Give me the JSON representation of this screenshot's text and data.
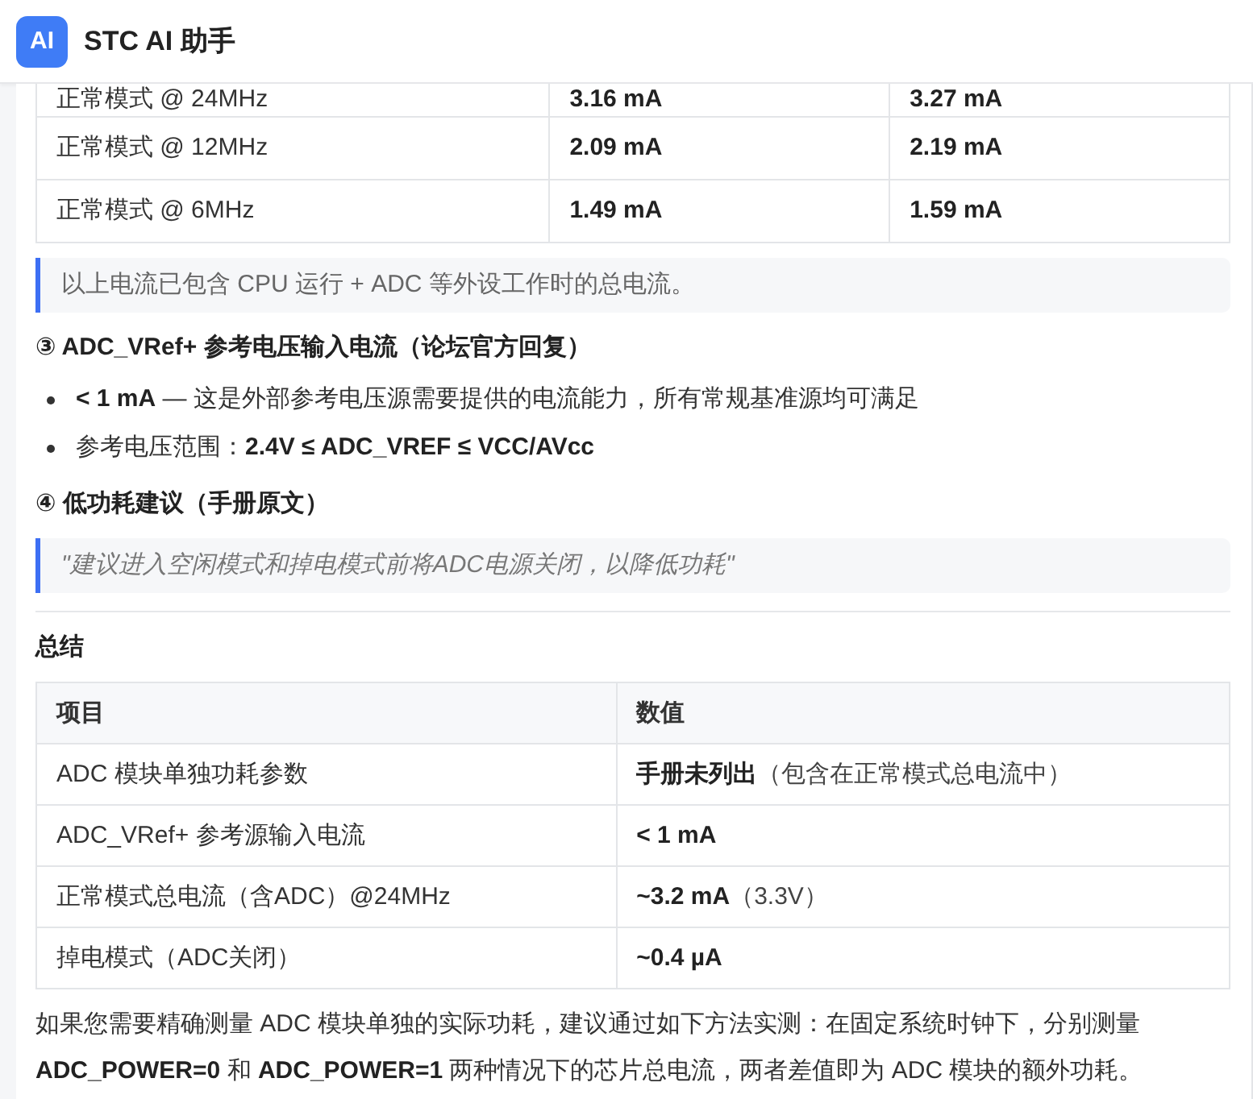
{
  "header": {
    "logo": "AI",
    "title": "STC AI 助手"
  },
  "blocks": [
    {
      "kind": "table",
      "rows": [
        {
          "clipped": true,
          "label": "正常模式 @ 24MHz",
          "values": [
            {
              "value": "3.16 mA"
            },
            {
              "value": "3.27 mA"
            }
          ]
        },
        {
          "clipped": false,
          "label": "正常模式 @ 12MHz",
          "values": [
            {
              "value": "2.09 mA"
            },
            {
              "value": "2.19 mA"
            }
          ]
        },
        {
          "clipped": false,
          "label": "正常模式 @ 6MHz",
          "values": [
            {
              "value": "1.49 mA"
            },
            {
              "value": "1.59 mA"
            }
          ]
        }
      ]
    },
    {
      "kind": "note",
      "text": "以上电流已包含 CPU 运行 + ADC 等外设工作时的总电流。"
    },
    {
      "kind": "heading",
      "text": "③ ADC_VRef+ 参考电压输入电流（论坛官方回复）"
    },
    {
      "kind": "list",
      "items": [
        "**< 1 mA** — 这是外部参考电压源需要提供的电流能力，所有常规基准源均可满足",
        "参考电压范围：**2.4V ≤ ADC_VREF ≤ VCC/AVcc**"
      ]
    },
    {
      "kind": "heading",
      "text": "④ 低功耗建议（手册原文）"
    },
    {
      "kind": "citation",
      "text": "\"建议进入空闲模式和掉电模式前将ADC电源关闭，以降低功耗\""
    },
    {
      "kind": "divider"
    },
    {
      "kind": "heading",
      "text": "总结"
    },
    {
      "kind": "table",
      "columns": [
        "项目",
        "数值"
      ],
      "rows": [
        {
          "clipped": false,
          "label": "ADC 模块单独功耗参数",
          "values": [
            {
              "value": "手册未列出",
              "note": "（包含在正常模式总电流中）"
            }
          ]
        },
        {
          "clipped": false,
          "label": "ADC_VRef+ 参考源输入电流",
          "values": [
            {
              "value": "< 1 mA"
            }
          ]
        },
        {
          "clipped": false,
          "label": "正常模式总电流（含ADC）@24MHz",
          "values": [
            {
              "value": "~3.2 mA",
              "note": "（3.3V）"
            }
          ]
        },
        {
          "clipped": false,
          "label": "掉电模式（ADC关闭）",
          "values": [
            {
              "value": "~0.4 µA"
            }
          ]
        }
      ]
    },
    {
      "kind": "paragraph",
      "text": "如果您需要精确测量 ADC 模块单独的实际功耗，建议通过如下方法实测：在固定系统时钟下，分别测量 **ADC_POWER=0** 和 **ADC_POWER=1** 两种情况下的芯片总电流，两者差值即为 ADC 模块的额外功耗。"
    }
  ]
}
